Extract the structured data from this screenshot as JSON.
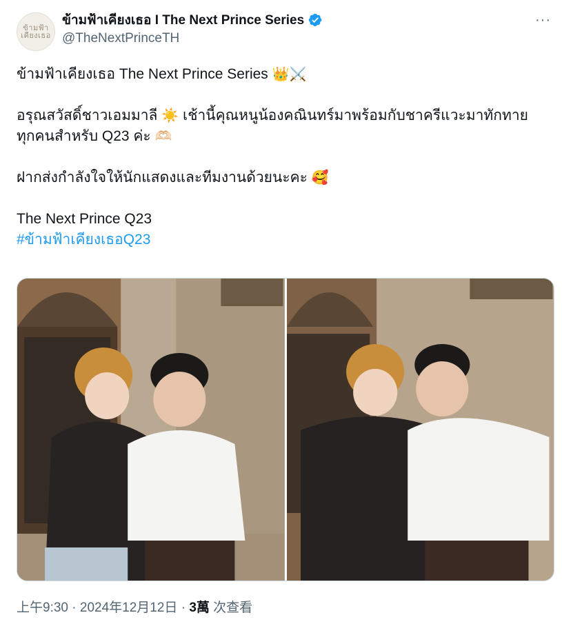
{
  "account": {
    "avatar_text": "ข้ามฟ้า เคียงเธอ",
    "display_name": "ข้ามฟ้าเคียงเธอ I The Next Prince Series",
    "handle": "@TheNextPrinceTH",
    "verified_icon": "verified-badge-icon",
    "verified_color": "#1d9bf0"
  },
  "menu": {
    "more_label": "···"
  },
  "post": {
    "line1": "ข้ามฟ้าเคียงเธอ The Next Prince Series",
    "line1_emoji": "👑⚔️",
    "line2a": "อรุณสวัสดิ์ชาวเอมมาลี",
    "line2_emoji": "☀️",
    "line2b": "เช้านี้คุณหนูน้องคณินทร์มาพร้อมกับชาครีแวะมาทักทาย",
    "line3": "ทุกคนสำหรับ Q23 ค่ะ",
    "line3_emoji": "🫶🏻",
    "line4": "ฝากส่งกำลังใจให้นักแสดงและทีมงานด้วยนะคะ",
    "line4_emoji": "🥰",
    "line5": "The Next Prince Q23",
    "hashtag": "#ข้ามฟ้าเคียงเธอQ23"
  },
  "media": {
    "photos": [
      {
        "label": "Photo 1"
      },
      {
        "label": "Photo 2"
      }
    ]
  },
  "footer": {
    "time": "上午9:30",
    "date": "2024年12月12日",
    "sep": "·",
    "views_count": "3萬",
    "views_label": "次查看"
  },
  "colors": {
    "text": "#0f1419",
    "secondary": "#536471",
    "link": "#1d9bf0"
  }
}
